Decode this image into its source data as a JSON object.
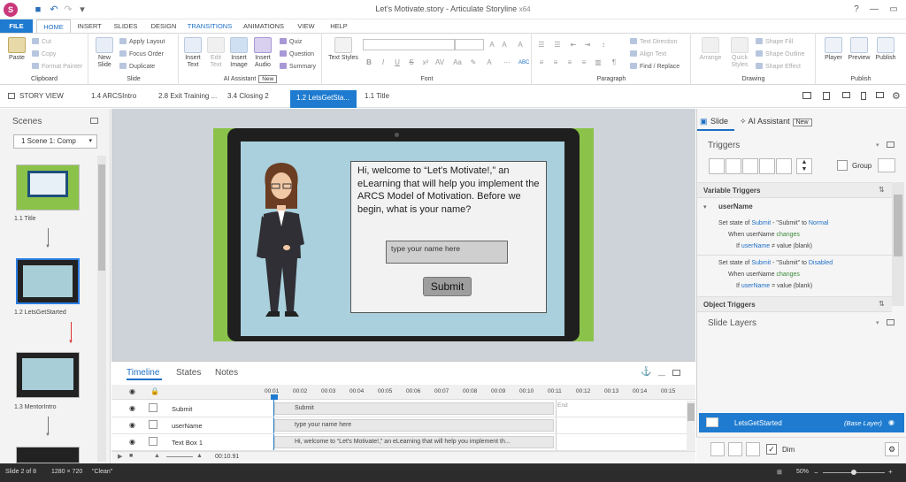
{
  "window": {
    "title": "Let's Motivate.story - Articulate Storyline",
    "arch": "x64",
    "logo": "S"
  },
  "menu_tabs": [
    "FILE",
    "HOME",
    "INSERT",
    "SLIDES",
    "DESIGN",
    "TRANSITIONS",
    "ANIMATIONS",
    "VIEW",
    "HELP"
  ],
  "ribbon": {
    "clipboard": {
      "paste": "Paste",
      "cut": "Cut",
      "copy": "Copy",
      "format_painter": "Format Painter",
      "label": "Clipboard"
    },
    "slide": {
      "new_slide": "New Slide",
      "apply_layout": "Apply Layout",
      "focus_order": "Focus Order",
      "duplicate": "Duplicate",
      "label": "Slide"
    },
    "ai": {
      "insert_text": "Insert Text",
      "edit_text": "Edit Text",
      "insert_image": "Insert Image",
      "insert_audio": "Insert Audio",
      "quiz": "Quiz",
      "question": "Question",
      "summary": "Summary",
      "label": "AI Assistant",
      "badge": "New"
    },
    "font": {
      "text_styles": "Text Styles",
      "label": "Font"
    },
    "paragraph": {
      "text_direction": "Text Direction",
      "align_text": "Align Text",
      "find_replace": "Find / Replace",
      "label": "Paragraph"
    },
    "drawing": {
      "arrange": "Arrange",
      "quick_styles": "Quick Styles",
      "shape_fill": "Shape Fill",
      "shape_outline": "Shape Outline",
      "shape_effect": "Shape Effect",
      "label": "Drawing"
    },
    "publish": {
      "player": "Player",
      "preview": "Preview",
      "publish": "Publish",
      "label": "Publish"
    }
  },
  "slide_tabs": [
    "STORY VIEW",
    "1.4 ARCSIntro",
    "2.8 Exit Training ...",
    "3.4 Closing 2",
    "1.2 LetsGetSta...",
    "1.1 Title"
  ],
  "scenes": {
    "title": "Scenes",
    "selector": "1 Scene 1: Comp",
    "slides": [
      "1.1 Title",
      "1.2 LetsGetStarted",
      "1.3 MentorIntro"
    ]
  },
  "stage": {
    "speech": "Hi, welcome to “Let's Motivate!,” an eLearning that will help you implement the ARCS Model of Motivation. Before we begin, what is your name?",
    "input_placeholder": "type your name here",
    "submit": "Submit"
  },
  "timeline": {
    "tabs": [
      "Timeline",
      "States",
      "Notes"
    ],
    "ticks": [
      "00:01",
      "00:02",
      "00:03",
      "00:04",
      "00:05",
      "00:06",
      "00:07",
      "00:08",
      "00:09",
      "00:10",
      "00:11",
      "00:12",
      "00:13",
      "00:14",
      "00:15"
    ],
    "end_label": "End",
    "rows": [
      {
        "name": "Submit",
        "bar": "Submit"
      },
      {
        "name": "userName",
        "bar": "type your name here"
      },
      {
        "name": "Text Box 1",
        "bar": "Hi, welcome to “Let's Motivate!,” an eLearning that will help you implement th..."
      }
    ],
    "time": "00:10.91"
  },
  "right_panel": {
    "tabs": {
      "slide": "Slide",
      "ai": "AI Assistant",
      "ai_badge": "New"
    },
    "triggers_title": "Triggers",
    "group_label": "Group",
    "variable_triggers": "Variable Triggers",
    "variable_name": "userName",
    "trigger1": {
      "l1a": "Set state of ",
      "l1b": "Submit",
      "l1c": " - \"Submit\" to ",
      "l1d": "Normal",
      "l2a": "When userName ",
      "l2b": "changes",
      "l3a": "If ",
      "l3b": "userName",
      "l3c": " ≠ value (blank)"
    },
    "trigger2": {
      "l1a": "Set state of ",
      "l1b": "Submit",
      "l1c": " - \"Submit\" to ",
      "l1d": "Disabled",
      "l2a": "When userName ",
      "l2b": "changes",
      "l3a": "If ",
      "l3b": "userName",
      "l3c": " = value (blank)"
    },
    "object_triggers": "Object Triggers",
    "slide_layers": "Slide Layers",
    "layer_name": "LetsGetStarted",
    "layer_type": "(Base Layer)",
    "dim": "Dim"
  },
  "status": {
    "slide": "Slide 2 of 8",
    "size": "1280 × 720",
    "theme": "\"Clean\"",
    "zoom": "50%"
  }
}
